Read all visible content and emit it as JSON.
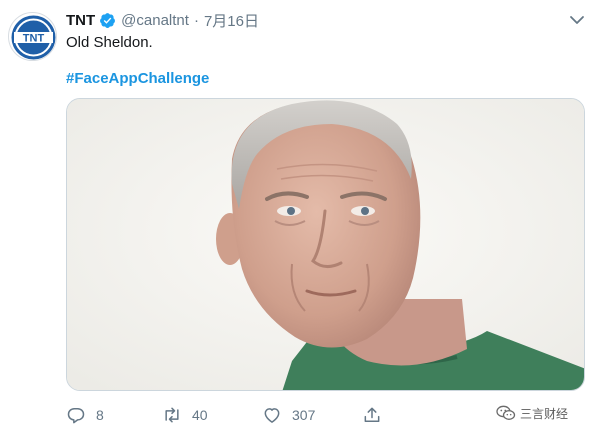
{
  "tweet": {
    "author_name": "TNT",
    "author_handle": "@canaltnt",
    "separator": "·",
    "timestamp": "7月16日",
    "text": "Old Sheldon.",
    "hashtag": "#FaceAppChallenge",
    "avatar_logo_text": "TNT"
  },
  "actions": {
    "reply_count": "8",
    "retweet_count": "40",
    "like_count": "307"
  },
  "watermark": {
    "label": "三言财经"
  },
  "colors": {
    "link": "#1b95e0",
    "muted": "#657786",
    "verified": "#1da1f2",
    "logo_blue": "#1f5fa8"
  },
  "icons": {
    "verified": "verified-badge-icon",
    "menu": "chevron-down-icon",
    "reply": "reply-icon",
    "retweet": "retweet-icon",
    "like": "heart-icon",
    "share": "share-icon",
    "watermark": "wechat-icon"
  }
}
